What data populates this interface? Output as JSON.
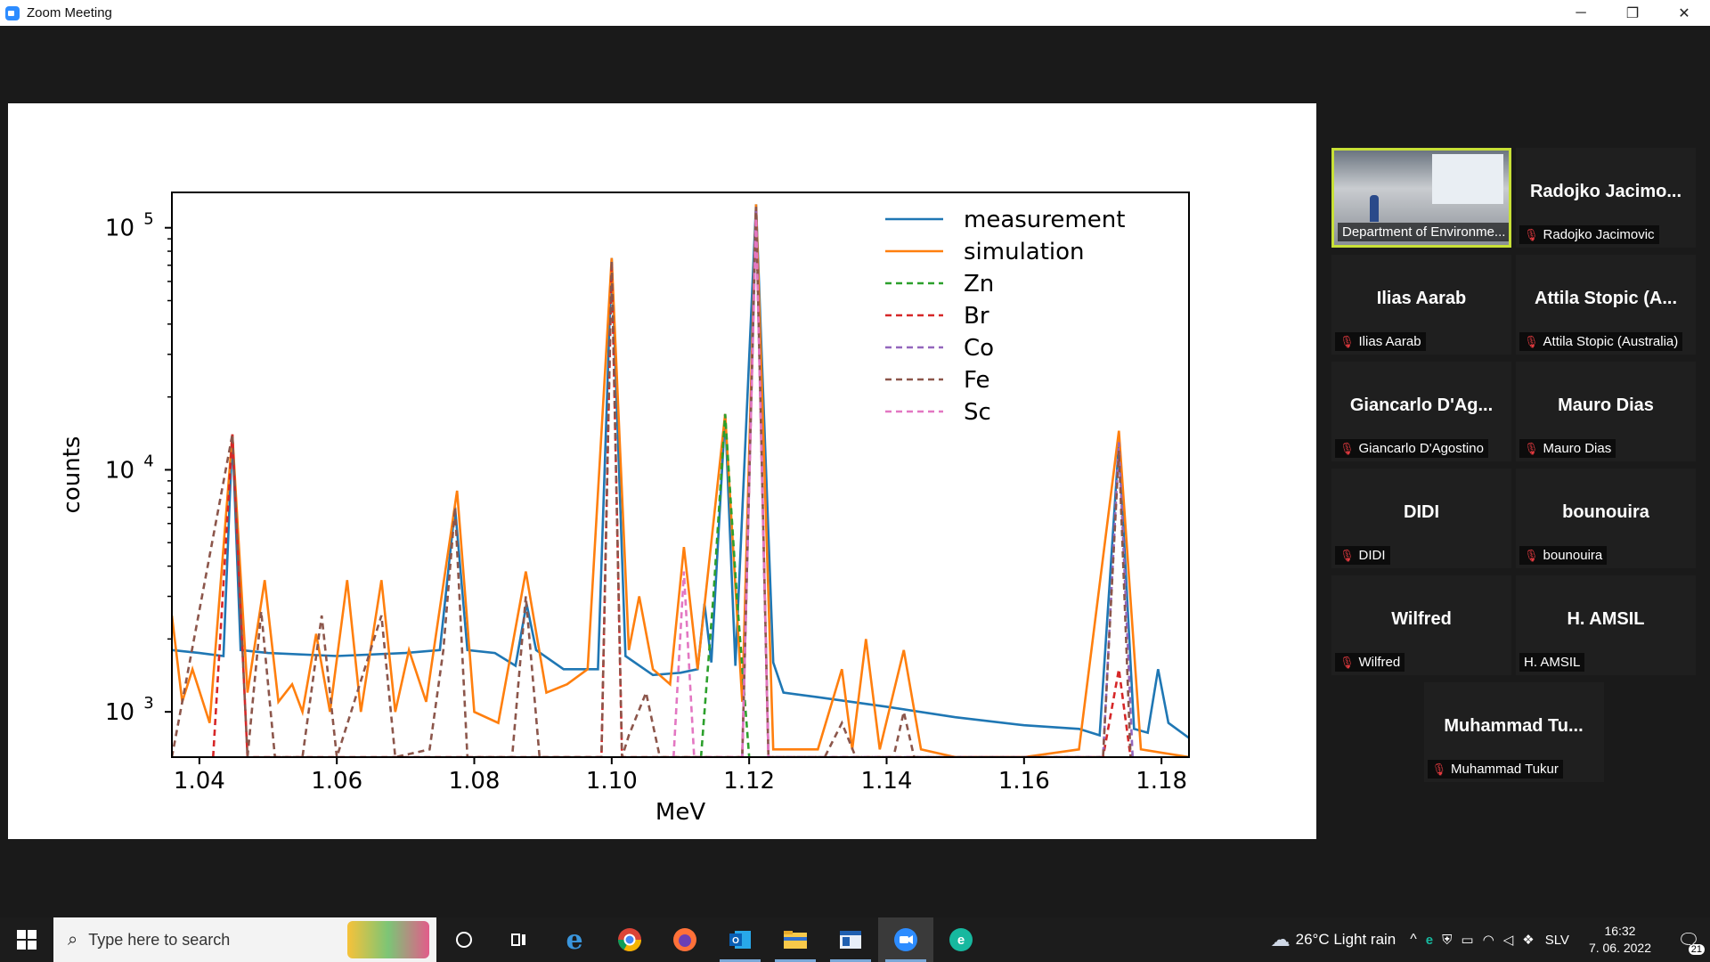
{
  "window": {
    "title": "Zoom Meeting",
    "minimize": "─",
    "restore": "❐",
    "close": "✕"
  },
  "chart_data": {
    "type": "line",
    "xlabel": "MeV",
    "ylabel": "counts",
    "yscale": "log",
    "xlim": [
      1.036,
      1.184
    ],
    "ylim": [
      650,
      140000
    ],
    "xticks": [
      "1.04",
      "1.06",
      "1.08",
      "1.10",
      "1.12",
      "1.14",
      "1.16",
      "1.18"
    ],
    "yticks": [
      {
        "base": "10",
        "exp": "3"
      },
      {
        "base": "10",
        "exp": "4"
      },
      {
        "base": "10",
        "exp": "5"
      }
    ],
    "legend_position": "top-right",
    "series": [
      {
        "name": "measurement",
        "color": "#1f77b4",
        "style": "solid",
        "points": [
          [
            1.036,
            1800
          ],
          [
            1.04,
            1750
          ],
          [
            1.0435,
            1700
          ],
          [
            1.0448,
            14000
          ],
          [
            1.046,
            1800
          ],
          [
            1.05,
            1750
          ],
          [
            1.06,
            1700
          ],
          [
            1.07,
            1750
          ],
          [
            1.075,
            1800
          ],
          [
            1.0772,
            7000
          ],
          [
            1.079,
            1800
          ],
          [
            1.083,
            1750
          ],
          [
            1.086,
            1550
          ],
          [
            1.0876,
            2800
          ],
          [
            1.089,
            1800
          ],
          [
            1.093,
            1500
          ],
          [
            1.098,
            1500
          ],
          [
            1.1,
            75000
          ],
          [
            1.102,
            1700
          ],
          [
            1.106,
            1420
          ],
          [
            1.11,
            1450
          ],
          [
            1.1125,
            1500
          ],
          [
            1.1135,
            2800
          ],
          [
            1.1145,
            1600
          ],
          [
            1.1165,
            17000
          ],
          [
            1.118,
            1550
          ],
          [
            1.121,
            125000
          ],
          [
            1.1235,
            1600
          ],
          [
            1.125,
            1200
          ],
          [
            1.13,
            1150
          ],
          [
            1.14,
            1050
          ],
          [
            1.15,
            950
          ],
          [
            1.16,
            880
          ],
          [
            1.168,
            850
          ],
          [
            1.171,
            800
          ],
          [
            1.1738,
            13000
          ],
          [
            1.176,
            850
          ],
          [
            1.178,
            820
          ],
          [
            1.1795,
            1500
          ],
          [
            1.181,
            900
          ],
          [
            1.184,
            780
          ]
        ]
      },
      {
        "name": "simulation",
        "color": "#ff7f0e",
        "style": "solid",
        "points": [
          [
            1.036,
            2500
          ],
          [
            1.0375,
            1100
          ],
          [
            1.039,
            1500
          ],
          [
            1.0415,
            900
          ],
          [
            1.0448,
            14000
          ],
          [
            1.047,
            1200
          ],
          [
            1.0495,
            3500
          ],
          [
            1.0515,
            1100
          ],
          [
            1.0535,
            1300
          ],
          [
            1.055,
            1000
          ],
          [
            1.057,
            2100
          ],
          [
            1.059,
            1000
          ],
          [
            1.0615,
            3500
          ],
          [
            1.0635,
            1000
          ],
          [
            1.0665,
            3500
          ],
          [
            1.0685,
            1000
          ],
          [
            1.0705,
            1800
          ],
          [
            1.073,
            1100
          ],
          [
            1.0775,
            8200
          ],
          [
            1.08,
            1000
          ],
          [
            1.0835,
            900
          ],
          [
            1.0875,
            3800
          ],
          [
            1.0905,
            1200
          ],
          [
            1.0935,
            1300
          ],
          [
            1.0965,
            1500
          ],
          [
            1.1,
            75000
          ],
          [
            1.1025,
            1800
          ],
          [
            1.104,
            3000
          ],
          [
            1.106,
            1500
          ],
          [
            1.1085,
            1300
          ],
          [
            1.1105,
            4800
          ],
          [
            1.1125,
            1500
          ],
          [
            1.1165,
            17000
          ],
          [
            1.119,
            1100
          ],
          [
            1.121,
            125000
          ],
          [
            1.1235,
            700
          ],
          [
            1.13,
            700
          ],
          [
            1.1335,
            1500
          ],
          [
            1.135,
            700
          ],
          [
            1.137,
            2000
          ],
          [
            1.139,
            700
          ],
          [
            1.1425,
            1800
          ],
          [
            1.145,
            700
          ],
          [
            1.15,
            650
          ],
          [
            1.16,
            650
          ],
          [
            1.168,
            700
          ],
          [
            1.1738,
            14500
          ],
          [
            1.177,
            700
          ],
          [
            1.184,
            650
          ]
        ]
      },
      {
        "name": "Zn",
        "color": "#2ca02c",
        "style": "dashed",
        "points": [
          [
            1.113,
            650
          ],
          [
            1.1148,
            3000
          ],
          [
            1.1165,
            17000
          ],
          [
            1.1182,
            3000
          ],
          [
            1.12,
            650
          ]
        ]
      },
      {
        "name": "Br",
        "color": "#d62728",
        "style": "dashed",
        "points": [
          [
            1.042,
            650
          ],
          [
            1.0448,
            14000
          ],
          [
            1.047,
            650
          ],
          [
            1.0985,
            650
          ],
          [
            1.1,
            72000
          ],
          [
            1.1015,
            650
          ],
          [
            1.119,
            650
          ],
          [
            1.121,
            120000
          ],
          [
            1.1228,
            650
          ],
          [
            1.1715,
            650
          ],
          [
            1.1738,
            1500
          ],
          [
            1.1755,
            650
          ]
        ]
      },
      {
        "name": "Co",
        "color": "#9467bd",
        "style": "dashed",
        "points": [
          [
            1.119,
            650
          ],
          [
            1.121,
            118000
          ],
          [
            1.1228,
            650
          ],
          [
            1.1715,
            650
          ],
          [
            1.1738,
            13000
          ],
          [
            1.1758,
            650
          ]
        ]
      },
      {
        "name": "Fe",
        "color": "#8c564b",
        "style": "dashed",
        "points": [
          [
            1.036,
            650
          ],
          [
            1.0448,
            14000
          ],
          [
            1.047,
            650
          ],
          [
            1.049,
            2600
          ],
          [
            1.051,
            650
          ],
          [
            1.055,
            650
          ],
          [
            1.0578,
            2500
          ],
          [
            1.06,
            650
          ],
          [
            1.0665,
            2500
          ],
          [
            1.0685,
            650
          ],
          [
            1.0735,
            700
          ],
          [
            1.0755,
            1800
          ],
          [
            1.0772,
            7000
          ],
          [
            1.079,
            650
          ],
          [
            1.0855,
            650
          ],
          [
            1.0875,
            3000
          ],
          [
            1.0895,
            650
          ],
          [
            1.0985,
            650
          ],
          [
            1.1,
            73000
          ],
          [
            1.1015,
            650
          ],
          [
            1.1025,
            800
          ],
          [
            1.105,
            1200
          ],
          [
            1.107,
            650
          ],
          [
            1.119,
            650
          ],
          [
            1.121,
            122000
          ],
          [
            1.1228,
            650
          ],
          [
            1.131,
            650
          ],
          [
            1.1335,
            900
          ],
          [
            1.1355,
            650
          ],
          [
            1.141,
            650
          ],
          [
            1.1425,
            1000
          ],
          [
            1.144,
            650
          ],
          [
            1.1715,
            650
          ],
          [
            1.1738,
            12000
          ],
          [
            1.1755,
            650
          ]
        ]
      },
      {
        "name": "Sc",
        "color": "#e377c2",
        "style": "dashed",
        "points": [
          [
            1.109,
            650
          ],
          [
            1.1105,
            3800
          ],
          [
            1.112,
            650
          ],
          [
            1.119,
            650
          ],
          [
            1.121,
            110000
          ],
          [
            1.1228,
            650
          ]
        ]
      }
    ]
  },
  "participants": [
    {
      "big": "",
      "label": "Department of Environme...",
      "active": true,
      "muted": false
    },
    {
      "big": "Radojko  Jacimo...",
      "label": "Radojko Jacimovic",
      "muted": true
    },
    {
      "big": "Ilias Aarab",
      "label": "Ilias Aarab",
      "muted": true
    },
    {
      "big": "Attila  Stopic  (A...",
      "label": "Attila Stopic (Australia)",
      "muted": true
    },
    {
      "big": "Giancarlo  D'Ag...",
      "label": "Giancarlo D'Agostino",
      "muted": true
    },
    {
      "big": "Mauro Dias",
      "label": "Mauro Dias",
      "muted": true
    },
    {
      "big": "DIDI",
      "label": "DIDI",
      "muted": true
    },
    {
      "big": "bounouira",
      "label": "bounouira",
      "muted": true
    },
    {
      "big": "Wilfred",
      "label": "Wilfred",
      "muted": true
    },
    {
      "big": "H. AMSIL",
      "label": "H. AMSIL",
      "muted": false
    },
    {
      "big": "Muhammad  Tu...",
      "label": "Muhammad Tukur",
      "muted": true
    }
  ],
  "taskbar": {
    "search_placeholder": "Type here to search",
    "weather": "26°C  Light rain",
    "language": "SLV",
    "time": "16:32",
    "date": "7. 06. 2022",
    "notifications": "21"
  },
  "colors": {
    "active_speaker": "#c8e036",
    "accent": "#2d8cff"
  }
}
